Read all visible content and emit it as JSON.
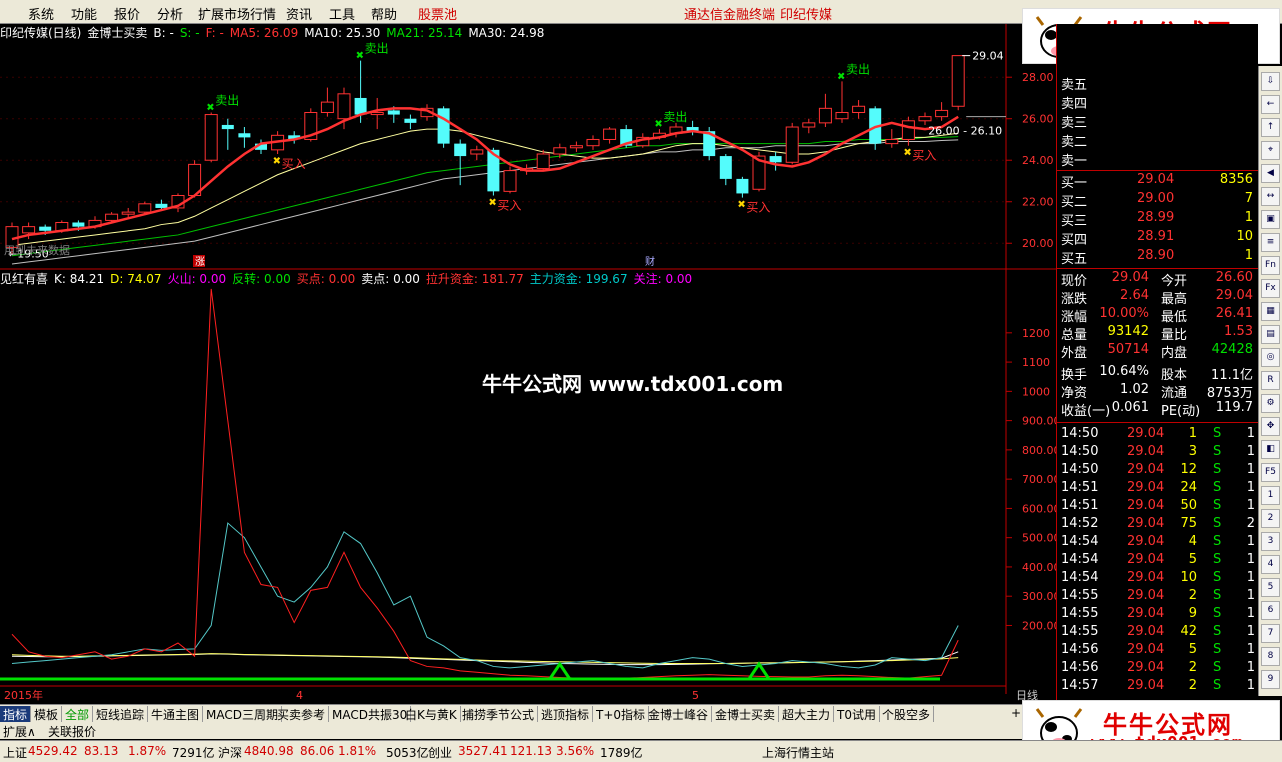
{
  "menu": {
    "items": [
      "系统",
      "功能",
      "报价",
      "分析",
      "扩展市场行情",
      "资讯",
      "工具",
      "帮助"
    ],
    "stock_pool": "股票池",
    "right_links": [
      "通达信金融终端",
      "印纪传媒"
    ]
  },
  "logo": {
    "title": "牛牛公式网",
    "url": "www.tdx001.com"
  },
  "chart": {
    "info": {
      "title": "印纪传媒(日线)",
      "formula": "金博士买卖",
      "b": "B: -",
      "s": "S: -",
      "f": "F: -",
      "ma5": "MA5: 26.09",
      "ma10": "MA10: 25.30",
      "ma21": "MA21: 25.14",
      "ma30": "MA30: 24.98"
    },
    "price_axis": [
      "28.00",
      "26.00",
      "24.00",
      "22.00",
      "20.00"
    ],
    "labels": {
      "high": "29.04",
      "low": "19.50",
      "range": "26.00 - 26.10",
      "notice": "用到未来数据",
      "zhang": "涨",
      "cai": "财",
      "sell": "卖出",
      "buy": "买入"
    },
    "candles": [
      {
        "o": 19.8,
        "c": 20.8,
        "h": 21.0,
        "l": 19.5
      },
      {
        "o": 20.5,
        "c": 20.8,
        "h": 21.0,
        "l": 20.2
      },
      {
        "o": 20.8,
        "c": 20.6,
        "h": 20.9,
        "l": 20.4
      },
      {
        "o": 20.6,
        "c": 21.0,
        "h": 21.1,
        "l": 20.5
      },
      {
        "o": 21.0,
        "c": 20.8,
        "h": 21.1,
        "l": 20.6
      },
      {
        "o": 20.8,
        "c": 21.1,
        "h": 21.3,
        "l": 20.7
      },
      {
        "o": 21.1,
        "c": 21.4,
        "h": 21.5,
        "l": 21.0
      },
      {
        "o": 21.4,
        "c": 21.5,
        "h": 21.7,
        "l": 21.2
      },
      {
        "o": 21.5,
        "c": 21.9,
        "h": 22.0,
        "l": 21.4
      },
      {
        "o": 21.9,
        "c": 21.7,
        "h": 22.1,
        "l": 21.6
      },
      {
        "o": 21.7,
        "c": 22.3,
        "h": 22.4,
        "l": 21.5
      },
      {
        "o": 22.3,
        "c": 23.8,
        "h": 24.0,
        "l": 22.2
      },
      {
        "o": 24.0,
        "c": 26.2,
        "h": 26.3,
        "l": 23.9
      },
      {
        "o": 25.7,
        "c": 25.5,
        "h": 26.0,
        "l": 24.5
      },
      {
        "o": 25.3,
        "c": 25.1,
        "h": 25.6,
        "l": 24.6
      },
      {
        "o": 24.8,
        "c": 24.5,
        "h": 25.0,
        "l": 24.3
      },
      {
        "o": 24.5,
        "c": 25.2,
        "h": 25.4,
        "l": 24.3
      },
      {
        "o": 25.2,
        "c": 25.0,
        "h": 25.4,
        "l": 24.8
      },
      {
        "o": 25.0,
        "c": 26.3,
        "h": 26.5,
        "l": 24.9
      },
      {
        "o": 26.3,
        "c": 26.8,
        "h": 27.5,
        "l": 26.1
      },
      {
        "o": 26.0,
        "c": 27.2,
        "h": 27.5,
        "l": 25.5
      },
      {
        "o": 27.0,
        "c": 26.2,
        "h": 28.8,
        "l": 25.8
      },
      {
        "o": 26.2,
        "c": 26.3,
        "h": 27.0,
        "l": 25.5
      },
      {
        "o": 26.4,
        "c": 26.2,
        "h": 26.6,
        "l": 25.8
      },
      {
        "o": 26.0,
        "c": 25.8,
        "h": 26.2,
        "l": 25.5
      },
      {
        "o": 26.1,
        "c": 26.5,
        "h": 26.7,
        "l": 25.9
      },
      {
        "o": 26.5,
        "c": 24.8,
        "h": 26.6,
        "l": 24.6
      },
      {
        "o": 24.8,
        "c": 24.2,
        "h": 25.0,
        "l": 22.8
      },
      {
        "o": 24.3,
        "c": 24.5,
        "h": 24.7,
        "l": 24.0
      },
      {
        "o": 24.5,
        "c": 22.5,
        "h": 24.6,
        "l": 22.3
      },
      {
        "o": 22.5,
        "c": 23.5,
        "h": 23.7,
        "l": 22.4
      },
      {
        "o": 23.5,
        "c": 23.6,
        "h": 23.8,
        "l": 23.3
      },
      {
        "o": 23.6,
        "c": 24.3,
        "h": 24.5,
        "l": 23.5
      },
      {
        "o": 24.3,
        "c": 24.6,
        "h": 24.8,
        "l": 24.1
      },
      {
        "o": 24.6,
        "c": 24.7,
        "h": 24.9,
        "l": 24.4
      },
      {
        "o": 24.7,
        "c": 25.0,
        "h": 25.2,
        "l": 24.5
      },
      {
        "o": 25.0,
        "c": 25.5,
        "h": 25.6,
        "l": 24.8
      },
      {
        "o": 25.5,
        "c": 24.7,
        "h": 25.7,
        "l": 24.6
      },
      {
        "o": 24.7,
        "c": 25.1,
        "h": 25.3,
        "l": 24.6
      },
      {
        "o": 25.1,
        "c": 25.3,
        "h": 25.5,
        "l": 25.0
      },
      {
        "o": 25.3,
        "c": 25.6,
        "h": 25.8,
        "l": 25.1
      },
      {
        "o": 25.6,
        "c": 25.4,
        "h": 25.9,
        "l": 25.2
      },
      {
        "o": 25.4,
        "c": 24.2,
        "h": 25.6,
        "l": 24.0
      },
      {
        "o": 24.2,
        "c": 23.1,
        "h": 24.3,
        "l": 22.8
      },
      {
        "o": 23.1,
        "c": 22.4,
        "h": 23.2,
        "l": 22.2
      },
      {
        "o": 22.6,
        "c": 24.2,
        "h": 24.4,
        "l": 22.5
      },
      {
        "o": 24.2,
        "c": 23.9,
        "h": 24.4,
        "l": 23.5
      },
      {
        "o": 23.9,
        "c": 25.6,
        "h": 25.8,
        "l": 23.8
      },
      {
        "o": 25.6,
        "c": 25.8,
        "h": 26.0,
        "l": 25.3
      },
      {
        "o": 25.8,
        "c": 26.5,
        "h": 27.2,
        "l": 25.6
      },
      {
        "o": 26.0,
        "c": 26.3,
        "h": 27.8,
        "l": 25.8
      },
      {
        "o": 26.3,
        "c": 26.6,
        "h": 26.9,
        "l": 26.0
      },
      {
        "o": 26.5,
        "c": 24.8,
        "h": 26.6,
        "l": 24.5
      },
      {
        "o": 24.8,
        "c": 25.0,
        "h": 25.5,
        "l": 24.6
      },
      {
        "o": 25.0,
        "c": 25.9,
        "h": 26.1,
        "l": 24.7
      },
      {
        "o": 25.9,
        "c": 26.1,
        "h": 26.3,
        "l": 25.7
      },
      {
        "o": 26.1,
        "c": 26.4,
        "h": 26.8,
        "l": 25.9
      },
      {
        "o": 26.6,
        "c": 29.04,
        "h": 29.04,
        "l": 26.41
      }
    ],
    "ma": {
      "ma5": [
        20.2,
        20.4,
        20.5,
        20.6,
        20.7,
        20.8,
        21.0,
        21.2,
        21.4,
        21.6,
        21.8,
        22.3,
        23.0,
        23.7,
        24.3,
        24.8,
        24.9,
        25.0,
        25.2,
        25.5,
        25.9,
        26.2,
        26.4,
        26.5,
        26.5,
        26.4,
        26.0,
        25.5,
        25.0,
        24.3,
        23.8,
        23.5,
        23.5,
        23.6,
        23.9,
        24.2,
        24.5,
        24.8,
        25.0,
        25.1,
        25.3,
        25.4,
        25.3,
        24.9,
        24.5,
        24.0,
        23.8,
        23.7,
        23.9,
        24.3,
        24.8,
        25.2,
        25.6,
        25.8,
        25.6,
        25.5,
        25.6,
        26.09
      ],
      "ma10": [
        19.9,
        20.0,
        20.1,
        20.2,
        20.3,
        20.4,
        20.5,
        20.6,
        20.7,
        20.9,
        21.0,
        21.3,
        21.7,
        22.1,
        22.5,
        22.9,
        23.3,
        23.6,
        23.9,
        24.2,
        24.5,
        24.8,
        25.0,
        25.2,
        25.4,
        25.5,
        25.5,
        25.4,
        25.2,
        25.0,
        24.8,
        24.6,
        24.4,
        24.3,
        24.2,
        24.1,
        24.1,
        24.2,
        24.3,
        24.5,
        24.7,
        24.8,
        24.8,
        24.7,
        24.6,
        24.5,
        24.4,
        24.3,
        24.3,
        24.4,
        24.6,
        24.8,
        24.9,
        25.0,
        25.1,
        25.1,
        25.2,
        25.3
      ],
      "ma21": [
        19.4,
        19.5,
        19.6,
        19.7,
        19.8,
        19.9,
        20.0,
        20.1,
        20.2,
        20.3,
        20.4,
        20.6,
        20.8,
        21.0,
        21.2,
        21.4,
        21.6,
        21.8,
        22.0,
        22.2,
        22.4,
        22.6,
        22.8,
        23.0,
        23.2,
        23.4,
        23.5,
        23.6,
        23.7,
        23.8,
        23.9,
        24.0,
        24.1,
        24.2,
        24.3,
        24.4,
        24.5,
        24.6,
        24.7,
        24.7,
        24.8,
        24.8,
        24.8,
        24.8,
        24.8,
        24.8,
        24.8,
        24.8,
        24.8,
        24.9,
        24.9,
        25.0,
        25.0,
        25.0,
        25.0,
        25.1,
        25.1,
        25.14
      ],
      "ma30": [
        19.0,
        19.1,
        19.2,
        19.3,
        19.4,
        19.5,
        19.6,
        19.7,
        19.8,
        19.9,
        20.0,
        20.1,
        20.3,
        20.5,
        20.7,
        20.9,
        21.1,
        21.3,
        21.5,
        21.7,
        21.9,
        22.1,
        22.3,
        22.5,
        22.7,
        22.9,
        23.1,
        23.2,
        23.3,
        23.4,
        23.5,
        23.6,
        23.7,
        23.8,
        23.9,
        24.0,
        24.1,
        24.2,
        24.3,
        24.4,
        24.4,
        24.5,
        24.5,
        24.6,
        24.6,
        24.6,
        24.7,
        24.7,
        24.7,
        24.7,
        24.8,
        24.8,
        24.8,
        24.9,
        24.9,
        24.9,
        24.95,
        24.98
      ]
    },
    "signals": [
      {
        "type": "sell",
        "i": 12
      },
      {
        "type": "buy",
        "i": 16
      },
      {
        "type": "sell",
        "i": 21
      },
      {
        "type": "buy",
        "i": 29
      },
      {
        "type": "sell",
        "i": 39
      },
      {
        "type": "buy",
        "i": 44
      },
      {
        "type": "sell",
        "i": 50
      },
      {
        "type": "buy",
        "i": 54
      }
    ],
    "indicator": {
      "name": "见红有喜",
      "k": "K: 84.21",
      "d": "D: 74.07",
      "huoshan": "火山: 0.00",
      "fanzhuan": "反转: 0.00",
      "maidian": "买点: 0.00",
      "maichu": "卖点: 0.00",
      "lasheng": "拉升资金: 181.77",
      "zhuli": "主力资金: 199.67",
      "guanzhu": "关注: 0.00"
    },
    "ind_axis": [
      "1200",
      "1100",
      "1000",
      "900.00",
      "800.00",
      "700.00",
      "600.00",
      "500.00",
      "400.00",
      "300.00",
      "200.00"
    ],
    "ind_data": {
      "red": [
        170,
        110,
        95,
        90,
        100,
        110,
        85,
        95,
        120,
        110,
        140,
        95,
        1350,
        900,
        450,
        340,
        330,
        210,
        320,
        330,
        450,
        330,
        260,
        180,
        80,
        60,
        55,
        45,
        40,
        35,
        30,
        28,
        25,
        22,
        20,
        18,
        18,
        20,
        22,
        25,
        28,
        30,
        32,
        30,
        28,
        26,
        25,
        24,
        24,
        28,
        30,
        28,
        25,
        22,
        20,
        25,
        30,
        150
      ],
      "cyan": [
        70,
        75,
        80,
        85,
        90,
        95,
        100,
        110,
        120,
        115,
        118,
        120,
        200,
        550,
        500,
        400,
        300,
        280,
        330,
        400,
        520,
        480,
        380,
        270,
        300,
        160,
        130,
        90,
        80,
        60,
        55,
        60,
        65,
        70,
        75,
        80,
        70,
        60,
        55,
        70,
        80,
        90,
        85,
        70,
        60,
        65,
        70,
        80,
        75,
        70,
        60,
        55,
        65,
        90,
        85,
        80,
        90,
        200
      ],
      "yellow": [
        100,
        98,
        96,
        95,
        95,
        96,
        97,
        98,
        99,
        100,
        101,
        102,
        104,
        103,
        101,
        100,
        99,
        98,
        97,
        96,
        95,
        94,
        93,
        92,
        90,
        88,
        86,
        84,
        82,
        80,
        79,
        78,
        77,
        76,
        75,
        74,
        73,
        72,
        71,
        70,
        70,
        70,
        70,
        70,
        71,
        72,
        72,
        73,
        74,
        75,
        76,
        77,
        78,
        80,
        82,
        84,
        86,
        90
      ],
      "white": [
        95,
        94,
        93,
        93,
        94,
        95,
        96,
        97,
        98,
        99,
        100,
        101,
        103,
        102,
        100,
        99,
        98,
        97,
        96,
        95,
        94,
        93,
        92,
        90,
        88,
        86,
        84,
        82,
        80,
        78,
        76,
        74,
        72,
        70,
        69,
        68,
        67,
        66,
        66,
        66,
        67,
        68,
        69,
        70,
        71,
        72,
        72,
        73,
        74,
        75,
        76,
        78,
        80,
        82,
        84,
        86,
        88,
        110
      ]
    },
    "date_labels": [
      "2015年",
      "4",
      "5"
    ],
    "watermark": "牛牛公式网 www.tdx001.com"
  },
  "quote": {
    "sell_levels": [
      "卖五",
      "卖四",
      "卖三",
      "卖二",
      "卖一"
    ],
    "buy": [
      {
        "label": "买一",
        "price": "29.04",
        "vol": "8356"
      },
      {
        "label": "买二",
        "price": "29.00",
        "vol": "7"
      },
      {
        "label": "买三",
        "price": "28.99",
        "vol": "1"
      },
      {
        "label": "买四",
        "price": "28.91",
        "vol": "10"
      },
      {
        "label": "买五",
        "price": "28.90",
        "vol": "1"
      }
    ],
    "stats": [
      {
        "l1": "现价",
        "v1": "29.04",
        "l2": "今开",
        "v2": "26.60",
        "c1": "red",
        "c2": "red"
      },
      {
        "l1": "涨跌",
        "v1": "2.64",
        "l2": "最高",
        "v2": "29.04",
        "c1": "red",
        "c2": "red"
      },
      {
        "l1": "涨幅",
        "v1": "10.00%",
        "l2": "最低",
        "v2": "26.41",
        "c1": "red",
        "c2": "red"
      },
      {
        "l1": "总量",
        "v1": "93142",
        "l2": "量比",
        "v2": "1.53",
        "c1": "yellow",
        "c2": "red"
      },
      {
        "l1": "外盘",
        "v1": "50714",
        "l2": "内盘",
        "v2": "42428",
        "c1": "red",
        "c2": "green"
      },
      {
        "l1": "换手",
        "v1": "10.64%",
        "l2": "股本",
        "v2": "11.1亿",
        "c1": "white",
        "c2": "white"
      },
      {
        "l1": "净资",
        "v1": "1.02",
        "l2": "流通",
        "v2": "8753万",
        "c1": "white",
        "c2": "white"
      },
      {
        "l1": "收益(一)",
        "v1": "0.061",
        "l2": "PE(动)",
        "v2": "119.7",
        "c1": "white",
        "c2": "white"
      }
    ],
    "ticks": [
      {
        "t": "14:50",
        "p": "29.04",
        "v": "1",
        "s": "S",
        "n": "1"
      },
      {
        "t": "14:50",
        "p": "29.04",
        "v": "3",
        "s": "S",
        "n": "1"
      },
      {
        "t": "14:50",
        "p": "29.04",
        "v": "12",
        "s": "S",
        "n": "1"
      },
      {
        "t": "14:51",
        "p": "29.04",
        "v": "24",
        "s": "S",
        "n": "1"
      },
      {
        "t": "14:51",
        "p": "29.04",
        "v": "50",
        "s": "S",
        "n": "1"
      },
      {
        "t": "14:52",
        "p": "29.04",
        "v": "75",
        "s": "S",
        "n": "2"
      },
      {
        "t": "14:54",
        "p": "29.04",
        "v": "4",
        "s": "S",
        "n": "1"
      },
      {
        "t": "14:54",
        "p": "29.04",
        "v": "5",
        "s": "S",
        "n": "1"
      },
      {
        "t": "14:54",
        "p": "29.04",
        "v": "10",
        "s": "S",
        "n": "1"
      },
      {
        "t": "14:55",
        "p": "29.04",
        "v": "2",
        "s": "S",
        "n": "1"
      },
      {
        "t": "14:55",
        "p": "29.04",
        "v": "9",
        "s": "S",
        "n": "1"
      },
      {
        "t": "14:55",
        "p": "29.04",
        "v": "42",
        "s": "S",
        "n": "1"
      },
      {
        "t": "14:56",
        "p": "29.04",
        "v": "5",
        "s": "S",
        "n": "1"
      },
      {
        "t": "14:56",
        "p": "29.04",
        "v": "2",
        "s": "S",
        "n": "1"
      },
      {
        "t": "14:57",
        "p": "29.04",
        "v": "2",
        "s": "S",
        "n": "1"
      }
    ]
  },
  "tabs": [
    "指标",
    "模板",
    "全部",
    "短线追踪",
    "牛通主图",
    "MACD三周期",
    "买卖参考",
    "MACD共振30",
    "白K与黄K",
    "捕捞季节公式",
    "逃顶指标",
    "T+0指标",
    "金博士峰谷",
    "金博士买卖",
    "超大主力",
    "T0试用",
    "个股空多"
  ],
  "tabs_extra": "+",
  "ind_corner": "日线",
  "subtabs": [
    "扩展∧",
    "关联报价"
  ],
  "status": {
    "sh_label": "上证",
    "sh_val": "4529.42",
    "sh_chg": "83.13",
    "sh_pct": "1.87%",
    "sh_amt": "7291亿",
    "sz_label": "沪深",
    "sz_val": "4840.98",
    "sz_chg": "86.06",
    "sz_pct": "1.81%",
    "sz_amt": "5053亿",
    "cy_label": "创业",
    "cy_val": "3527.41",
    "cy_chg": "121.13",
    "cy_pct": "3.56%",
    "cy_amt": "1789亿",
    "server": "上海行情主站"
  },
  "colors": {
    "up": "#ff3232",
    "down": "#54fcfc",
    "ma5": "#ff3232",
    "ma10": "#ffffa0",
    "ma21": "#00c000",
    "ma30": "#c0c0c0"
  }
}
